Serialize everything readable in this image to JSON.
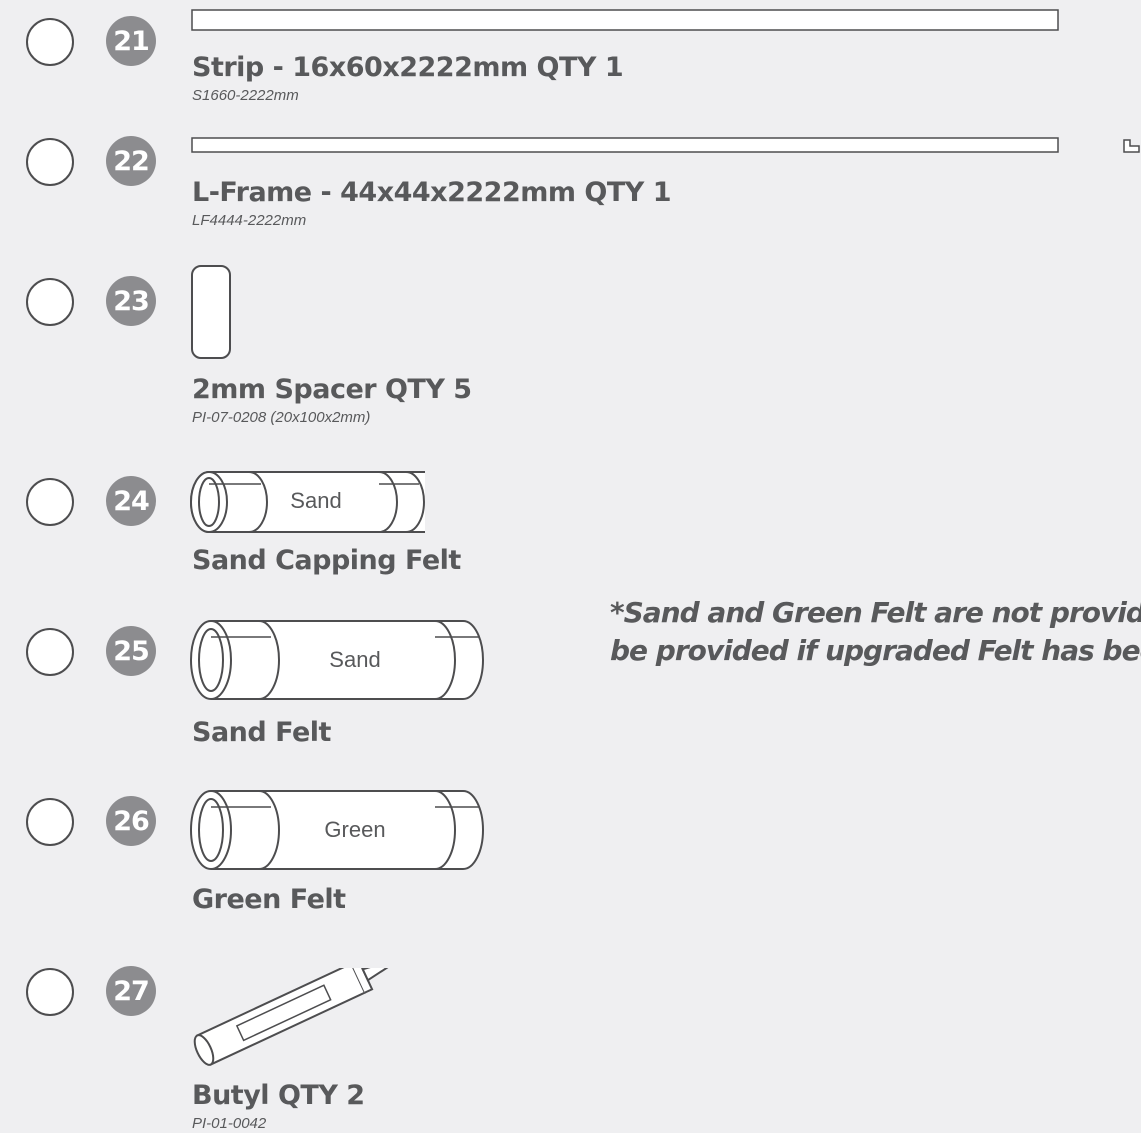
{
  "items": [
    {
      "number": "21",
      "title": "Strip - 16x60x2222mm QTY 1",
      "code": "S1660-2222mm"
    },
    {
      "number": "22",
      "title": "L-Frame - 44x44x2222mm QTY 1",
      "code": "LF4444-2222mm"
    },
    {
      "number": "23",
      "title": "2mm Spacer QTY 5",
      "code": "PI-07-0208 (20x100x2mm)"
    },
    {
      "number": "24",
      "title": "Sand Capping Felt",
      "roll_label": "Sand"
    },
    {
      "number": "25",
      "title": "Sand Felt",
      "roll_label": "Sand"
    },
    {
      "number": "26",
      "title": "Green Felt",
      "roll_label": "Green"
    },
    {
      "number": "27",
      "title": "Butyl QTY 2",
      "code": "PI-01-0042"
    }
  ],
  "note": {
    "line1": "*Sand and Green Felt are not provide",
    "line2": "be provided if upgraded Felt has bee"
  },
  "icons": {
    "checkbox": "checkbox-circle",
    "strip": "strip-bar-icon",
    "lframe": "l-frame-bar-icon",
    "lframe_profile": "l-profile-icon",
    "spacer": "spacer-icon",
    "felt_roll": "felt-roll-icon",
    "butyl_tube": "butyl-tube-icon"
  },
  "colors": {
    "background": "#efeff1",
    "badge": "#8c8c8f",
    "text": "#58595b",
    "line": "#4d4d4f"
  }
}
